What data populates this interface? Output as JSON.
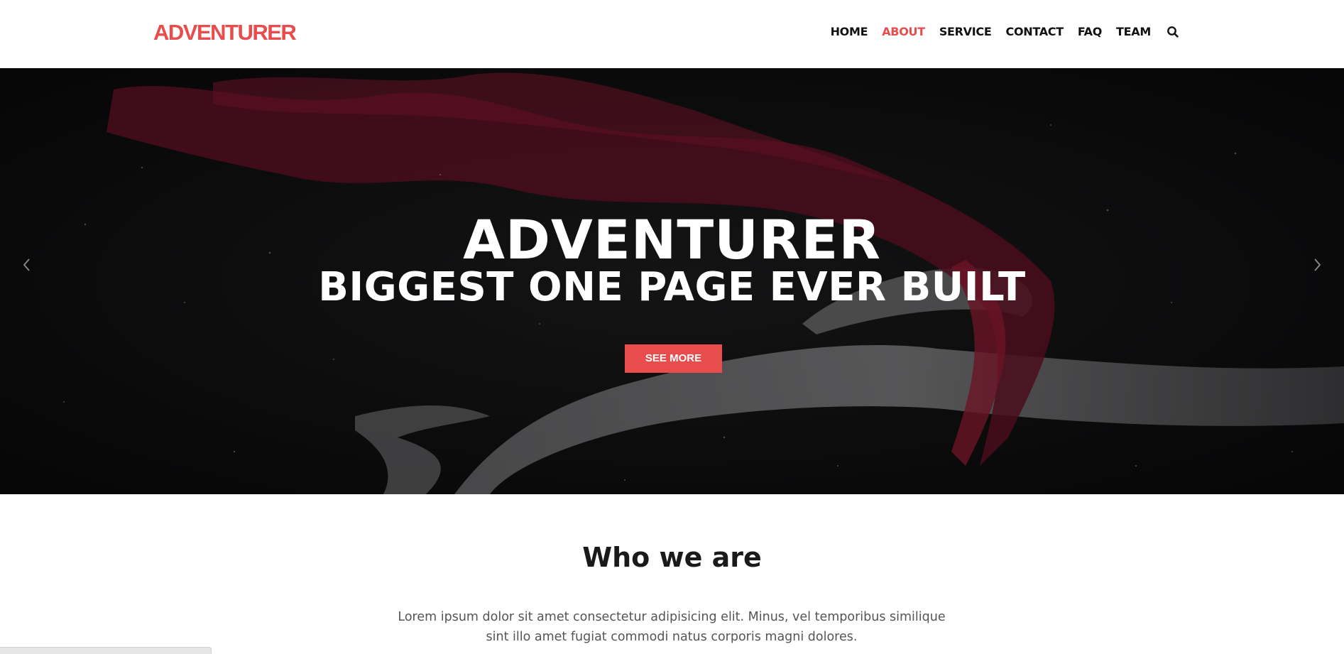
{
  "brand": {
    "logo_text": "ADVENTURER",
    "accent_color": "#e84c4c"
  },
  "nav": {
    "items": [
      {
        "label": "HOME",
        "active": false
      },
      {
        "label": "ABOUT",
        "active": true
      },
      {
        "label": "SERVICE",
        "active": false
      },
      {
        "label": "CONTACT",
        "active": false
      },
      {
        "label": "FAQ",
        "active": false
      },
      {
        "label": "TEAM",
        "active": false
      }
    ],
    "search_icon": "search-icon"
  },
  "hero": {
    "title": "ADVENTURER",
    "subtitle": "BIGGEST ONE PAGE EVER BUILT",
    "button_label": "SEE MORE",
    "prev_icon": "chevron-left-icon",
    "next_icon": "chevron-right-icon"
  },
  "about": {
    "heading": "Who we are",
    "text": "Lorem ipsum dolor sit amet consectetur adipisicing elit. Minus, vel temporibus similique sint illo amet fugiat commodi natus corporis magni dolores."
  }
}
